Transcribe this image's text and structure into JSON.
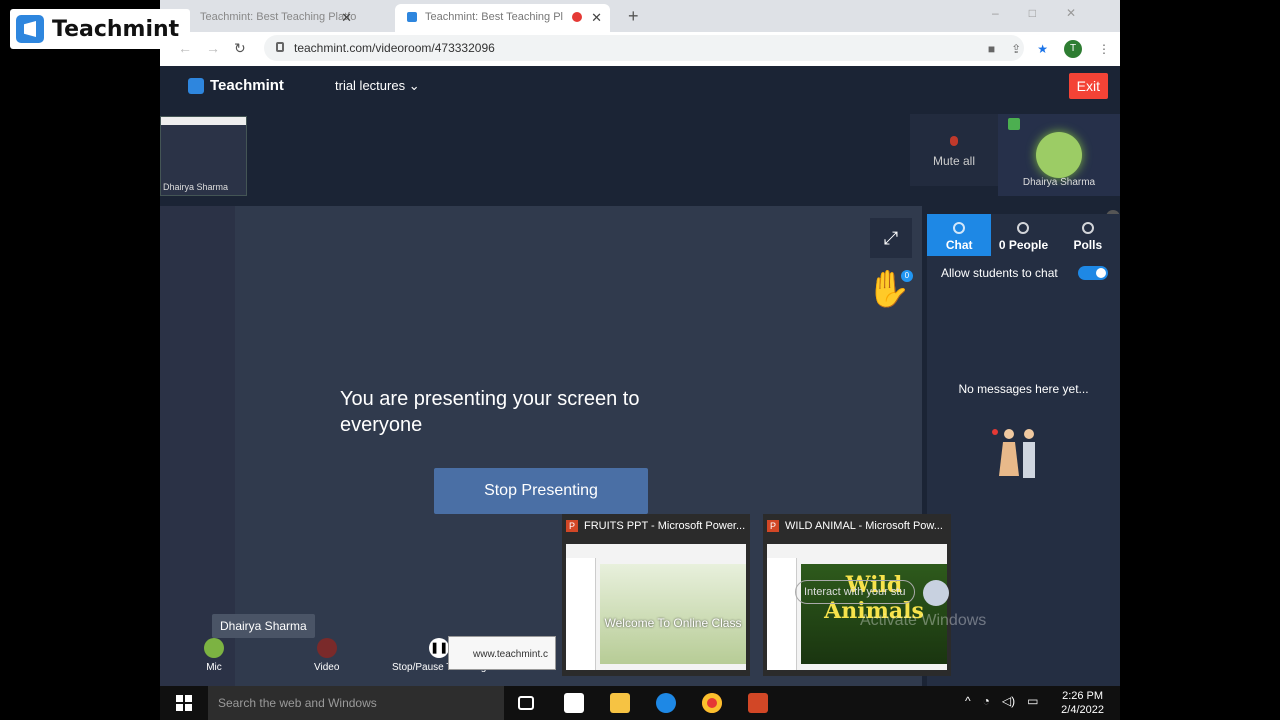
{
  "watermark": {
    "brand": "Teachmint"
  },
  "browser": {
    "tabs": [
      {
        "title": "Teachmint: Best Teaching Platfo",
        "active": false
      },
      {
        "title": "Teachmint: Best Teaching Pl",
        "active": true,
        "recording": true
      }
    ],
    "new_tab": "+",
    "url": "teachmint.com/videoroom/473332096",
    "profile_initial": "T"
  },
  "app": {
    "brand": "Teachmint",
    "class_selector": "trial lectures",
    "exit_label": "Exit",
    "thumbnail_name": "Dhairya Sharma",
    "mute_all_label": "Mute all",
    "self_name": "Dhairya Sharma",
    "hand_count": "0",
    "presenting_message": "You are presenting your screen to everyone",
    "stop_presenting_label": "Stop Presenting",
    "name_chip": "Dhairya Sharma",
    "controls": {
      "mic": "Mic",
      "video": "Video",
      "stop_pause": "Stop/Pause Teaching"
    }
  },
  "panel": {
    "tabs": [
      {
        "label": "Chat",
        "active": true
      },
      {
        "label": "0 People",
        "active": false
      },
      {
        "label": "Polls",
        "active": false
      }
    ],
    "allow_chat_label": "Allow students to chat",
    "allow_chat_enabled": true,
    "empty_message": "No messages here yet...",
    "chat_placeholder": "Interact with your stu"
  },
  "previews": [
    {
      "title": "FRUITS PPT - Microsoft Power...",
      "slide_text": "Welcome To Online Class"
    },
    {
      "title": "WILD ANIMAL - Microsoft Pow...",
      "slide_text": "Wild Animals"
    }
  ],
  "url_tooltip": "www.teachmint.c",
  "activate_windows": "Activate Windows",
  "taskbar": {
    "search_placeholder": "Search the web and Windows",
    "time": "2:26 PM",
    "date": "2/4/2022"
  },
  "colors": {
    "app_bg": "#1b2435",
    "accent": "#1e88e5",
    "exit": "#f44336",
    "stop_button": "#4a6fa5"
  }
}
